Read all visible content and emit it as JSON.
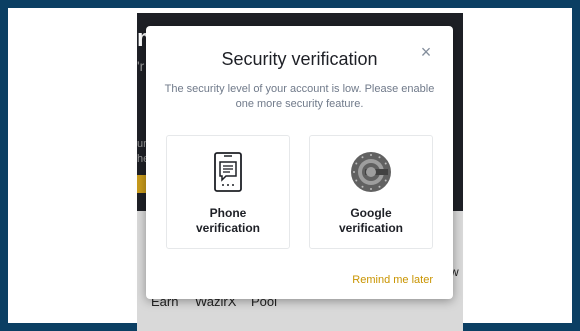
{
  "background": {
    "fragment_top": "m",
    "fragment_line2": "'r",
    "fragment_mid1": "ur",
    "fragment_mid2": "he",
    "tabs": [
      "Earn",
      "WazirX",
      "Pool"
    ],
    "edge_text": "w"
  },
  "modal": {
    "title": "Security verification",
    "description": "The security level of your account is low. Please enable one more security feature.",
    "options": [
      {
        "label_line1": "Phone",
        "label_line2": "verification",
        "icon": "phone-icon"
      },
      {
        "label_line1": "Google",
        "label_line2": "verification",
        "icon": "google-authenticator-icon"
      }
    ],
    "remind_label": "Remind me later",
    "close_symbol": "×"
  },
  "colors": {
    "accent": "#c99400",
    "frame": "#0b3f63"
  }
}
